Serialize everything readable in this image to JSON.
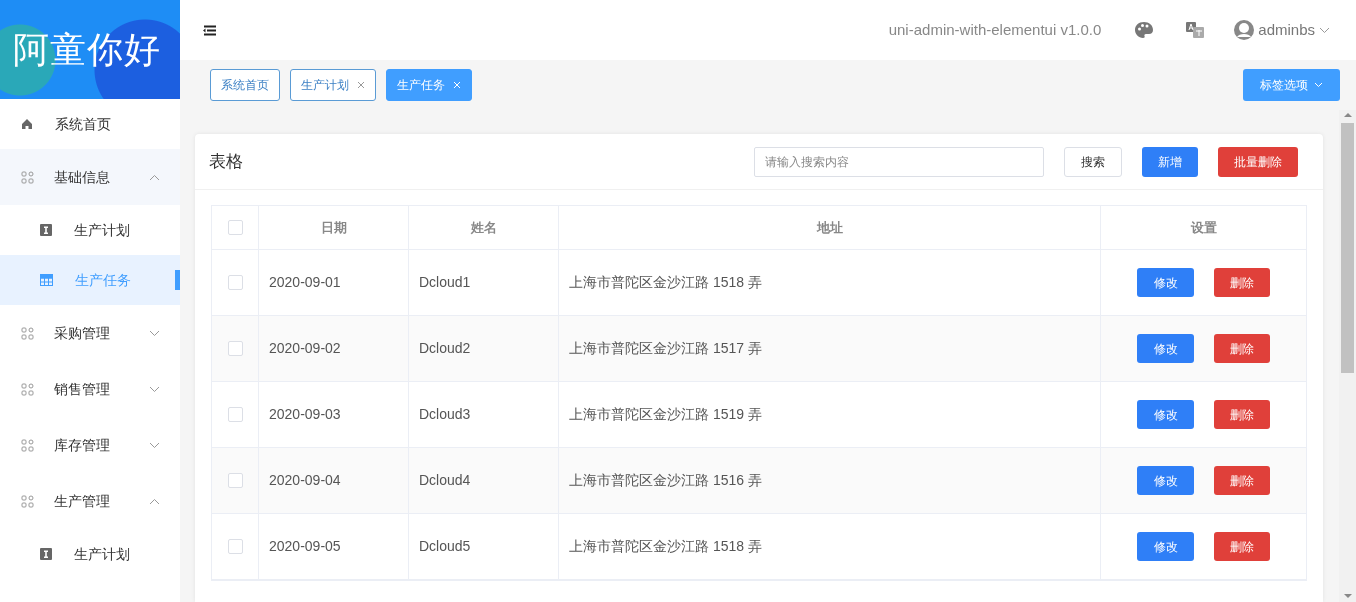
{
  "logo": {
    "text": "阿童你好"
  },
  "sidebar": {
    "items": [
      {
        "label": "系统首页",
        "kind": "home",
        "selected": false
      },
      {
        "label": "基础信息",
        "kind": "group",
        "expanded": true,
        "children": [
          {
            "label": "生产计划",
            "kind": "plan",
            "selected": false
          },
          {
            "label": "生产任务",
            "kind": "task",
            "selected": true
          }
        ]
      },
      {
        "label": "采购管理",
        "kind": "group",
        "expanded": false
      },
      {
        "label": "销售管理",
        "kind": "group",
        "expanded": false
      },
      {
        "label": "库存管理",
        "kind": "group",
        "expanded": false
      },
      {
        "label": "生产管理",
        "kind": "group",
        "expanded": true,
        "children": [
          {
            "label": "生产计划",
            "kind": "plan",
            "selected": false
          }
        ]
      }
    ]
  },
  "header": {
    "app_version": "uni-admin-with-elementui v1.0.0",
    "user": "adminbs"
  },
  "tags": [
    {
      "label": "系统首页",
      "closable": false,
      "selected": false
    },
    {
      "label": "生产计划",
      "closable": true,
      "selected": false
    },
    {
      "label": "生产任务",
      "closable": true,
      "selected": true
    }
  ],
  "tag_options": "标签选项",
  "card": {
    "title": "表格",
    "search": {
      "placeholder": "请输入搜索内容"
    },
    "buttons": [
      {
        "label": "搜索",
        "kind": "plain"
      },
      {
        "label": "新增",
        "kind": "primary"
      },
      {
        "label": "批量删除",
        "kind": "danger"
      }
    ]
  },
  "table": {
    "columns": [
      "日期",
      "姓名",
      "地址",
      "设置"
    ],
    "header_checked": false,
    "rows": [
      {
        "checked": false,
        "date": "2020-09-01",
        "name": "Dcloud1",
        "address": "上海市普陀区金沙江路 1518 弄",
        "edit": "修改",
        "delete": "删除"
      },
      {
        "checked": false,
        "date": "2020-09-02",
        "name": "Dcloud2",
        "address": "上海市普陀区金沙江路 1517 弄",
        "edit": "修改",
        "delete": "删除"
      },
      {
        "checked": false,
        "date": "2020-09-03",
        "name": "Dcloud3",
        "address": "上海市普陀区金沙江路 1519 弄",
        "edit": "修改",
        "delete": "删除"
      },
      {
        "checked": false,
        "date": "2020-09-04",
        "name": "Dcloud4",
        "address": "上海市普陀区金沙江路 1516 弄",
        "edit": "修改",
        "delete": "删除"
      },
      {
        "checked": false,
        "date": "2020-09-05",
        "name": "Dcloud5",
        "address": "上海市普陀区金沙江路 1518 弄",
        "edit": "修改",
        "delete": "删除"
      }
    ]
  }
}
